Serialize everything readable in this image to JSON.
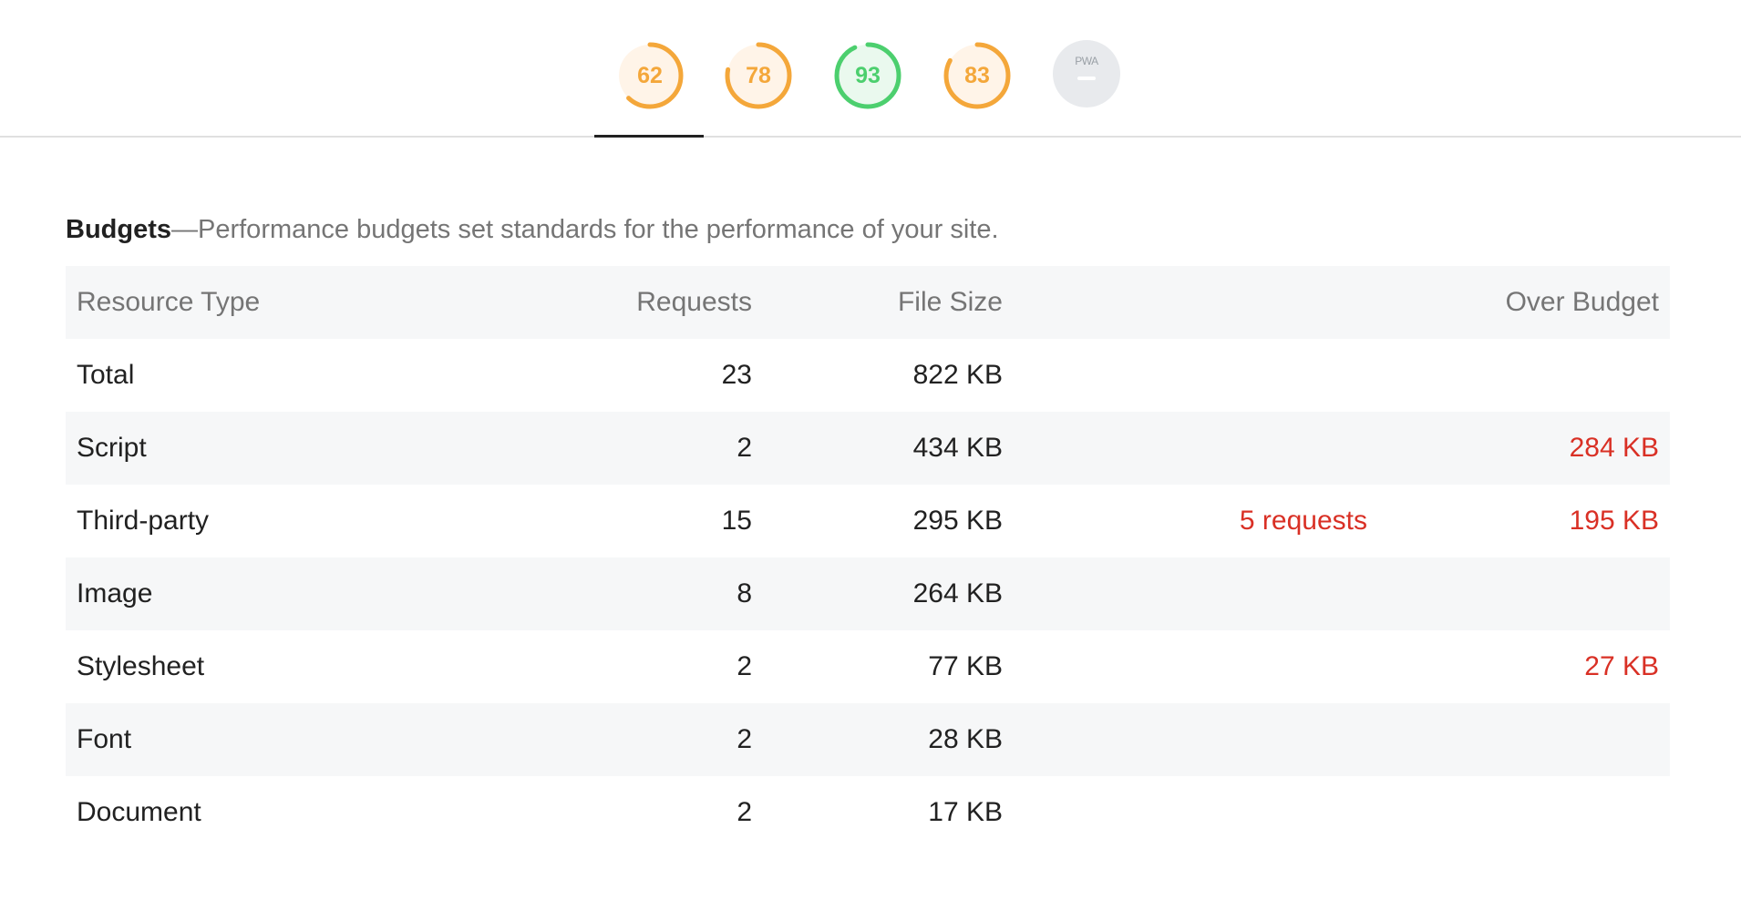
{
  "gauges": [
    {
      "label": "62",
      "value": 62,
      "color": "#f4a73a",
      "bg": "#fff4e8"
    },
    {
      "label": "78",
      "value": 78,
      "color": "#f4a73a",
      "bg": "#fff4e8"
    },
    {
      "label": "93",
      "value": 93,
      "color": "#4ccf6e",
      "bg": "#eaf9ee"
    },
    {
      "label": "83",
      "value": 83,
      "color": "#f4a73a",
      "bg": "#fff4e8"
    }
  ],
  "pwa": {
    "label": "PWA"
  },
  "budgets": {
    "title": "Budgets",
    "separator": "—",
    "description": "Performance budgets set standards for the performance of your site.",
    "headers": {
      "resource_type": "Resource Type",
      "requests": "Requests",
      "file_size": "File Size",
      "over_budget": "Over Budget"
    },
    "rows": [
      {
        "type": "Total",
        "requests": "23",
        "size": "822 KB",
        "over_requests": "",
        "over_size": ""
      },
      {
        "type": "Script",
        "requests": "2",
        "size": "434 KB",
        "over_requests": "",
        "over_size": "284 KB"
      },
      {
        "type": "Third-party",
        "requests": "15",
        "size": "295 KB",
        "over_requests": "5 requests",
        "over_size": "195 KB"
      },
      {
        "type": "Image",
        "requests": "8",
        "size": "264 KB",
        "over_requests": "",
        "over_size": ""
      },
      {
        "type": "Stylesheet",
        "requests": "2",
        "size": "77 KB",
        "over_requests": "",
        "over_size": "27 KB"
      },
      {
        "type": "Font",
        "requests": "2",
        "size": "28 KB",
        "over_requests": "",
        "over_size": ""
      },
      {
        "type": "Document",
        "requests": "2",
        "size": "17 KB",
        "over_requests": "",
        "over_size": ""
      }
    ]
  },
  "colors": {
    "over_budget": "#d93025",
    "average": "#f4a73a",
    "pass": "#4ccf6e"
  }
}
